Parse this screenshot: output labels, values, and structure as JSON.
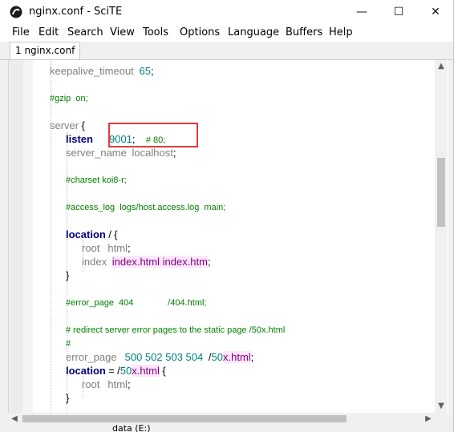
{
  "window": {
    "title": "nginx.conf - SciTE",
    "controls": [
      "—",
      "☐",
      "✕"
    ]
  },
  "menubar": [
    "File",
    "Edit",
    "Search",
    "View",
    "Tools",
    "Options",
    "Language",
    "Buffers",
    "Help"
  ],
  "tab": {
    "label": "1 nginx.conf"
  },
  "code": {
    "l1": {
      "kw": "keepalive_timeout",
      "num": "65",
      "op": ";"
    },
    "l2": {
      "cm": "#gzip  on;"
    },
    "l3": {
      "kw": "server",
      "op": "{"
    },
    "l4": {
      "kw": "listen",
      "num": "9001",
      "op": ";",
      "cm": "# 80;"
    },
    "l5": {
      "kw": "server_name",
      "val": "localhost",
      "op": ";"
    },
    "l6": {
      "cm": "#charset koi8-r;"
    },
    "l7": {
      "cm": "#access_log  logs/host.access.log  main;"
    },
    "l8": {
      "kw": "location",
      "op1": "/",
      "op2": "{"
    },
    "l9": {
      "kw": "root",
      "val": "html",
      "op": ";"
    },
    "l10": {
      "kw": "index",
      "str": "index.html index.htm",
      "op": ";"
    },
    "l11": {
      "op": "}"
    },
    "l12": {
      "cm": "#error_page  404              /404.html;"
    },
    "l13": {
      "cm": "# redirect server error pages to the static page /50x.html"
    },
    "l14": {
      "cm": "#"
    },
    "l15": {
      "kw": "error_page",
      "nums": "500 502 503 504",
      "path_a": "/",
      "path_b": "50",
      "str": "x.html",
      "op": ";"
    },
    "l16": {
      "kw": "location",
      "op1": "=",
      "path_a": "/",
      "path_b": "50",
      "str": "x.html",
      "op2": "{"
    },
    "l17": {
      "kw": "root",
      "val": "html",
      "op": ";"
    },
    "l18": {
      "op": "}"
    }
  },
  "background": {
    "partial_label": "data (E:)"
  },
  "colors": {
    "keyword": "#00007f",
    "number": "#007f7f",
    "comment": "#007f00",
    "string_bg": "#ffe6ff",
    "highlight": "#e03a3a"
  }
}
